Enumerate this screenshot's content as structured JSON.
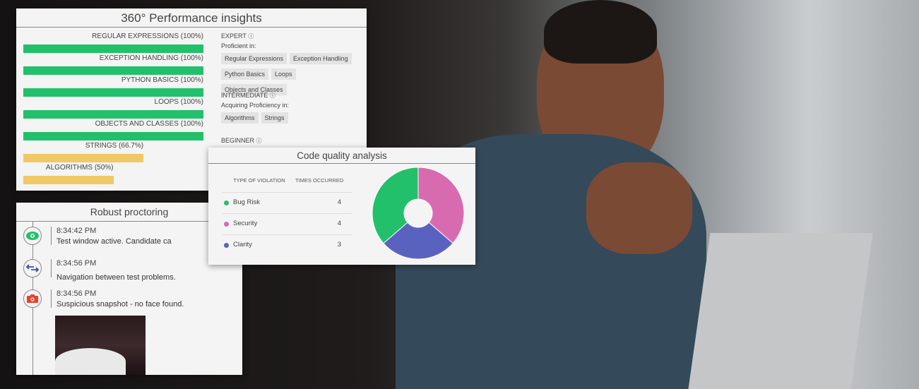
{
  "performance": {
    "title": "360° Performance insights",
    "skills": [
      {
        "label": "REGULAR EXPRESSIONS (100%)",
        "percent": 100,
        "color": "#22c06a"
      },
      {
        "label": "EXCEPTION HANDLING (100%)",
        "percent": 100,
        "color": "#22c06a"
      },
      {
        "label": "PYTHON BASICS (100%)",
        "percent": 100,
        "color": "#22c06a"
      },
      {
        "label": "LOOPS (100%)",
        "percent": 100,
        "color": "#22c06a"
      },
      {
        "label": "OBJECTS AND CLASSES (100%)",
        "percent": 100,
        "color": "#22c06a"
      },
      {
        "label": "STRINGS (66.7%)",
        "percent": 66.7,
        "color": "#f0c866"
      },
      {
        "label": "ALGORITHMS (50%)",
        "percent": 50,
        "color": "#f0c866"
      }
    ],
    "levels": [
      {
        "name": "EXPERT",
        "caption": "Proficient in:",
        "tags": [
          "Regular Expressions",
          "Exception Handling",
          "Python Basics",
          "Loops",
          "Objects and Classes"
        ]
      },
      {
        "name": "INTERMEDIATE",
        "caption": "Acquiring Proficiency in:",
        "tags": [
          "Algorithms",
          "Strings"
        ]
      },
      {
        "name": "BEGINNER",
        "caption": "",
        "tags": []
      }
    ]
  },
  "proctoring": {
    "title": "Robust proctoring",
    "events": [
      {
        "time": "8:34:42 PM",
        "text": "Test window active. Candidate ca",
        "icon": "eye-icon",
        "color": "#22c06a"
      },
      {
        "time": "8:34:56 PM",
        "text": "Navigation between test problems.",
        "icon": "arrows-swap-icon",
        "color": "#3a4fa0"
      },
      {
        "time": "8:34:56 PM",
        "text": "Suspicious snapshot - no face found.",
        "icon": "camera-icon",
        "color": "#e8432f"
      }
    ]
  },
  "code_quality": {
    "title": "Code quality analysis",
    "col_type": "TYPE OF VIOLATION",
    "col_times": "TIMES OCCURRED",
    "rows": [
      {
        "name": "Bug Risk",
        "count": "4",
        "color": "#22c06a"
      },
      {
        "name": "Security",
        "count": "4",
        "color": "#d86bb0"
      },
      {
        "name": "Clarity",
        "count": "3",
        "color": "#5a62c0"
      }
    ]
  },
  "chart_data": {
    "type": "pie",
    "donut": true,
    "categories": [
      "Security",
      "Clarity",
      "Bug Risk"
    ],
    "values": [
      4,
      3,
      4
    ],
    "colors": [
      "#d86bb0",
      "#5a62c0",
      "#22c06a"
    ]
  }
}
